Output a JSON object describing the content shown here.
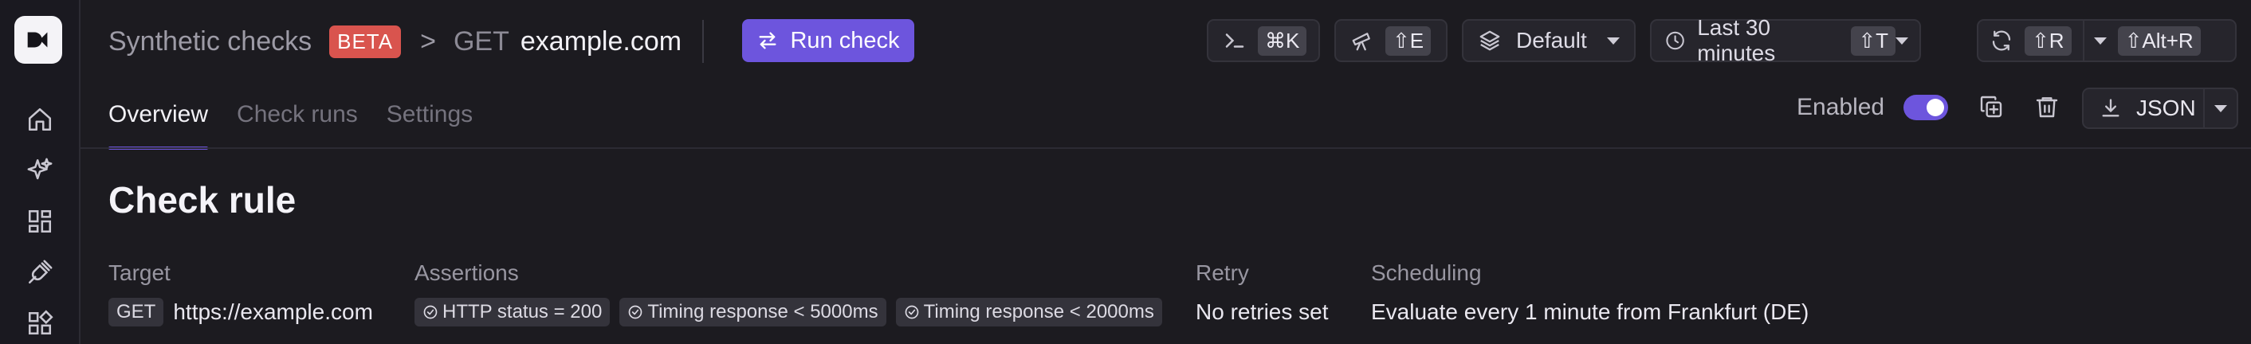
{
  "header": {
    "section": "Synthetic checks",
    "badge": "BETA",
    "separator": ">",
    "method": "GET",
    "host": "example.com",
    "run_label": "Run check",
    "terminal_key": "⌘K",
    "explore_key": "⇧E",
    "environment": "Default",
    "time_range": "Last 30 minutes",
    "time_key": "⇧T",
    "refresh_key": "⇧R",
    "auto_refresh_key": "⇧Alt+R"
  },
  "tabs": [
    {
      "label": "Overview",
      "active": true
    },
    {
      "label": "Check runs",
      "active": false
    },
    {
      "label": "Settings",
      "active": false
    }
  ],
  "status": {
    "enabled_label": "Enabled",
    "enabled": true
  },
  "export": {
    "label": "JSON"
  },
  "rule": {
    "title": "Check rule",
    "target_label": "Target",
    "target_method": "GET",
    "target_url": "https://example.com",
    "assertions_label": "Assertions",
    "assertions": [
      "HTTP status = 200",
      "Timing response < 5000ms",
      "Timing response < 2000ms"
    ],
    "retry_label": "Retry",
    "retry_value": "No retries set",
    "scheduling_label": "Scheduling",
    "scheduling_value": "Evaluate every 1 minute from Frankfurt (DE)"
  },
  "sidebar": {
    "icons": [
      "home-icon",
      "sparkles-icon",
      "dashboard-icon",
      "plug-icon",
      "integrations-icon"
    ]
  },
  "colors": {
    "accent": "#6d55dd",
    "beta_badge": "#d9544e",
    "background": "#1c1b20"
  }
}
